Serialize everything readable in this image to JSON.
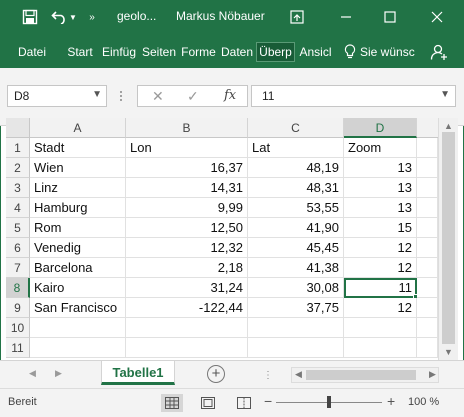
{
  "app": {
    "filename": "geolo...",
    "user": "Markus Nöbauer",
    "accent_color": "#217346",
    "title_icons": [
      "save-icon",
      "undo-icon",
      "undo-dropdown-icon",
      "more-commands-icon",
      "restore-ribbon-icon",
      "minimize-icon",
      "maximize-icon",
      "close-icon"
    ]
  },
  "ribbon": {
    "tabs": [
      "Datei",
      "Start",
      "Einfüg",
      "Seiten",
      "Forme",
      "Daten",
      "Überp",
      "Ansicl"
    ],
    "active_tab": "Überp",
    "tell_me": "Sie wünsc",
    "share_icon": "share-person-icon"
  },
  "formula_bar": {
    "name_box": "D8",
    "cancel_icon": "✕",
    "confirm_icon": "✓",
    "fx_label": "fx",
    "value": "11"
  },
  "grid": {
    "columns": [
      "A",
      "B",
      "C",
      "D"
    ],
    "selected_column": "D",
    "row_numbers": [
      "1",
      "2",
      "3",
      "4",
      "5",
      "6",
      "7",
      "8",
      "9",
      "10",
      "11"
    ],
    "selected_row": "8",
    "rows": [
      [
        "Stadt",
        "Lon",
        "Lat",
        "Zoom"
      ],
      [
        "Wien",
        "16,37",
        "48,19",
        "13"
      ],
      [
        "Linz",
        "14,31",
        "48,31",
        "13"
      ],
      [
        "Hamburg",
        "9,99",
        "53,55",
        "13"
      ],
      [
        "Rom",
        "12,50",
        "41,90",
        "15"
      ],
      [
        "Venedig",
        "12,32",
        "45,45",
        "12"
      ],
      [
        "Barcelona",
        "2,18",
        "41,38",
        "12"
      ],
      [
        "Kairo",
        "31,24",
        "30,08",
        "11"
      ],
      [
        "San Francisco",
        "-122,44",
        "37,75",
        "12"
      ],
      [
        "",
        "",
        "",
        ""
      ],
      [
        "",
        "",
        "",
        ""
      ]
    ],
    "active_cell": "D8"
  },
  "sheets": {
    "tabs": [
      "Tabelle1"
    ],
    "active": "Tabelle1",
    "add_icon": "+"
  },
  "status": {
    "ready": "Bereit",
    "zoom": "100 %",
    "zoom_minus": "−",
    "zoom_plus": "+"
  }
}
